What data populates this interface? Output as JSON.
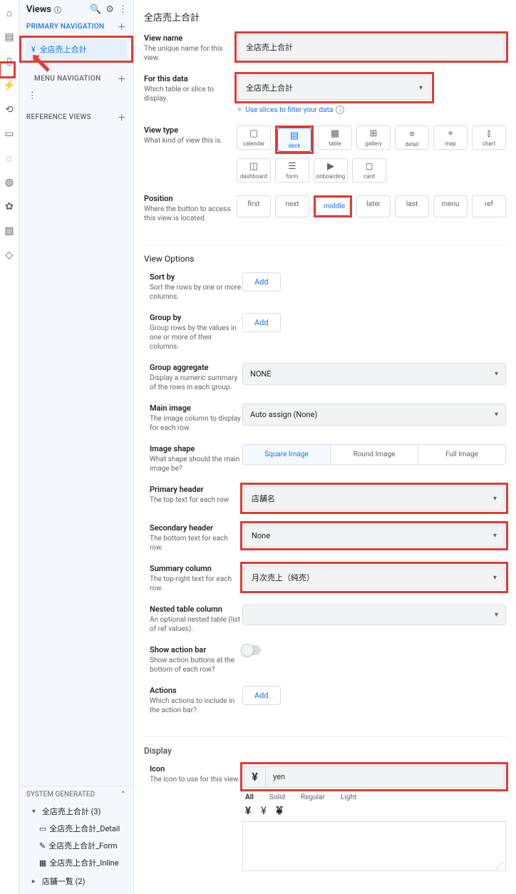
{
  "rail": {
    "items": [
      "home",
      "data",
      "views",
      "bolt",
      "automation",
      "info",
      "dashboard",
      "bulb",
      "globe",
      "settings",
      "monitor",
      "education"
    ]
  },
  "side": {
    "title": "Views",
    "primary": {
      "header": "PRIMARY NAVIGATION",
      "item": "全店売上合計"
    },
    "menu": {
      "header": "MENU NAVIGATION"
    },
    "reference": {
      "header": "REFERENCE VIEWS"
    },
    "system": {
      "header": "SYSTEM GENERATED",
      "group": "全店売上合計 (3)",
      "items": [
        "全店売上合計_Detail",
        "全店売上合計_Form",
        "全店売上合計_Inline"
      ],
      "group2": "店舗一覧 (2)"
    }
  },
  "main": {
    "title": "全店売上合計",
    "fields": {
      "view_name": {
        "label": "View name",
        "desc": "The unique name for this view.",
        "value": "全店売上合計"
      },
      "for_data": {
        "label": "For this data",
        "desc": "Which table or slice to display.",
        "value": "全店売上合計",
        "link": "Use slices to filter your data"
      },
      "view_type": {
        "label": "View type",
        "desc": "What kind of view this is.",
        "tiles": [
          "calendar",
          "deck",
          "table",
          "gallery",
          "detail",
          "map",
          "chart",
          "dashboard",
          "form",
          "onboarding",
          "card"
        ],
        "selected": "deck"
      },
      "position": {
        "label": "Position",
        "desc": "Where the button to access this view is located.",
        "opts": [
          "first",
          "next",
          "middle",
          "later",
          "last",
          "menu",
          "ref"
        ],
        "selected": "middle"
      },
      "view_options_header": "View Options",
      "sort_by": {
        "label": "Sort by",
        "desc": "Sort the rows by one or more columns.",
        "btn": "Add"
      },
      "group_by": {
        "label": "Group by",
        "desc": "Group rows by the values in one or more of their columns.",
        "btn": "Add"
      },
      "group_agg": {
        "label": "Group aggregate",
        "desc": "Display a numeric summary of the rows in each group.",
        "value": "NONE"
      },
      "main_image": {
        "label": "Main image",
        "desc": "The image column to display for each row.",
        "value": "Auto assign (None)"
      },
      "image_shape": {
        "label": "Image shape",
        "desc": "What shape should the main image be?",
        "opts": [
          "Square Image",
          "Round Image",
          "Full Image"
        ],
        "selected": "Square Image"
      },
      "primary_hdr": {
        "label": "Primary header",
        "desc": "The top text for each row",
        "value": "店舗名"
      },
      "secondary_hdr": {
        "label": "Secondary header",
        "desc": "The bottom text for each row.",
        "value": "None"
      },
      "summary_col": {
        "label": "Summary column",
        "desc": "The top-right text for each row.",
        "value": "月次売上（純売）"
      },
      "nested": {
        "label": "Nested table column",
        "desc": "An optional nested table (list of ref values).",
        "value": ""
      },
      "show_action": {
        "label": "Show action bar",
        "desc": "Show action buttons at the bottom of each row?"
      },
      "actions": {
        "label": "Actions",
        "desc": "Which actions to include in the action bar?",
        "btn": "Add"
      },
      "display_header": "Display",
      "icon": {
        "label": "Icon",
        "desc": "The icon to use for this view.",
        "value": "yen",
        "glyph": "¥",
        "tabs": [
          "All",
          "Solid",
          "Regular",
          "Light"
        ],
        "tab_selected": "All"
      }
    }
  }
}
